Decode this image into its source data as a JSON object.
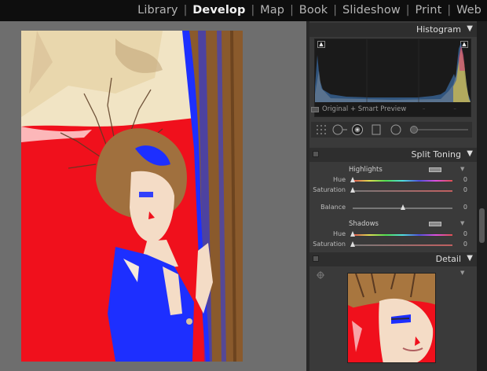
{
  "modules": {
    "library": "Library",
    "develop": "Develop",
    "map": "Map",
    "book": "Book",
    "slideshow": "Slideshow",
    "print": "Print",
    "web": "Web",
    "separator": "|"
  },
  "histogram": {
    "title": "Histogram",
    "info": "Original + Smart Preview",
    "tick": "–"
  },
  "split_toning": {
    "title": "Split Toning",
    "highlights": {
      "label": "Highlights",
      "hue_label": "Hue",
      "hue_value": "0",
      "saturation_label": "Saturation",
      "saturation_value": "0"
    },
    "balance_label": "Balance",
    "balance_value": "0",
    "shadows": {
      "label": "Shadows",
      "hue_label": "Hue",
      "hue_value": "0",
      "saturation_label": "Saturation",
      "saturation_value": "0"
    }
  },
  "detail": {
    "title": "Detail"
  },
  "glyphs": {
    "collapse": "▼",
    "expand": "▲",
    "clip": "▲"
  },
  "colors": {
    "photo_red": "#f0101c",
    "photo_blue": "#1d2fff",
    "panel_bg": "#3a3a3a",
    "stage_bg": "#6e6e6e"
  },
  "icons": {
    "grid": "grid-overlay-icon",
    "crop": "crop-icon",
    "spot": "spot-removal-icon",
    "redeye": "red-eye-icon",
    "grad": "graduated-filter-icon",
    "radial": "radial-filter-icon",
    "brush": "adjustment-brush-icon",
    "target": "target-adjust-icon"
  }
}
